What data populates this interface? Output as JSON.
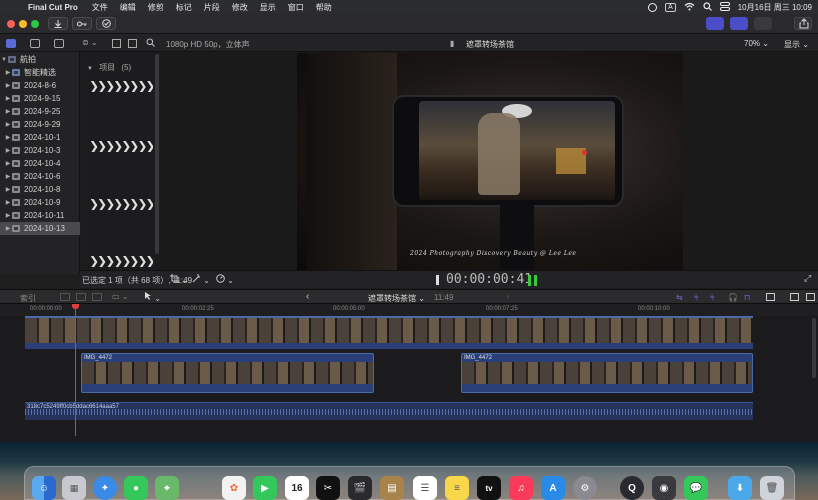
{
  "menubar": {
    "app_name": "Final Cut Pro",
    "items": [
      "文件",
      "编辑",
      "修剪",
      "标记",
      "片段",
      "修改",
      "显示",
      "窗口",
      "帮助"
    ],
    "clock": "10月16日 周三  10:09",
    "icons": [
      "apple-icon",
      "record-icon",
      "input-method-icon",
      "wifi-icon",
      "search-icon",
      "control-center-icon"
    ],
    "input_method": "A"
  },
  "toolbar": {
    "buttons": [
      "import-icon",
      "keyword-icon",
      "check-icon"
    ]
  },
  "browser": {
    "library_name": "航拍",
    "sidebar_items": [
      {
        "label": "航拍",
        "indent": 0
      },
      {
        "label": "智能精选",
        "indent": 1
      },
      {
        "label": "2024-8-6",
        "indent": 1
      },
      {
        "label": "2024-9-15",
        "indent": 1
      },
      {
        "label": "2024-9-25",
        "indent": 1
      },
      {
        "label": "2024-9-29",
        "indent": 1
      },
      {
        "label": "2024-10-1",
        "indent": 1
      },
      {
        "label": "2024-10-3",
        "indent": 1
      },
      {
        "label": "2024-10-4",
        "indent": 1
      },
      {
        "label": "2024-10-6",
        "indent": 1
      },
      {
        "label": "2024-10-8",
        "indent": 1
      },
      {
        "label": "2024-10-9",
        "indent": 1
      },
      {
        "label": "2024-10-11",
        "indent": 1
      },
      {
        "label": "2024-10-13",
        "indent": 1
      }
    ],
    "section_label": "项目",
    "section_count": "(5)",
    "selection_status": "已选定 1 项（共 68 项）, 11:49"
  },
  "viewer": {
    "format": "1080p HD 50p，立体声",
    "project_title": "遮罩转场茶馆",
    "zoom": "70%",
    "view_menu": "显示",
    "timecode": "00:00:00:41",
    "overlay_text": "2024 Photography Discovery  Beauty @ Lee Lee"
  },
  "timeline": {
    "index_label": "索引",
    "project_name": "遮罩转场茶馆",
    "duration": "11:49",
    "ruler_marks": [
      "00:00:00:00",
      "00:00:02:25",
      "00:00:05:00",
      "00:00:07:25",
      "00:00:10:00"
    ],
    "clips": [
      {
        "name": "IMG_4472"
      },
      {
        "name": "IMG_4472"
      }
    ],
    "audio_clip_name": "318c7c5249ff0cb5ddac6614aaa57"
  },
  "dock": {
    "apps": [
      "finder-icon",
      "launchpad-icon",
      "safari-icon",
      "messages-icon",
      "maps-icon",
      "photos-icon",
      "facetime-icon",
      "calendar-icon",
      "capcut-icon",
      "final-cut-icon",
      "notes-icon",
      "reminders-icon",
      "tv-icon",
      "music-icon",
      "app-store-icon",
      "system-settings-icon",
      "quicktime-icon",
      "photo-booth-icon",
      "wechat-icon",
      "downloads-icon",
      "trash-icon"
    ],
    "calendar_day": "16"
  }
}
